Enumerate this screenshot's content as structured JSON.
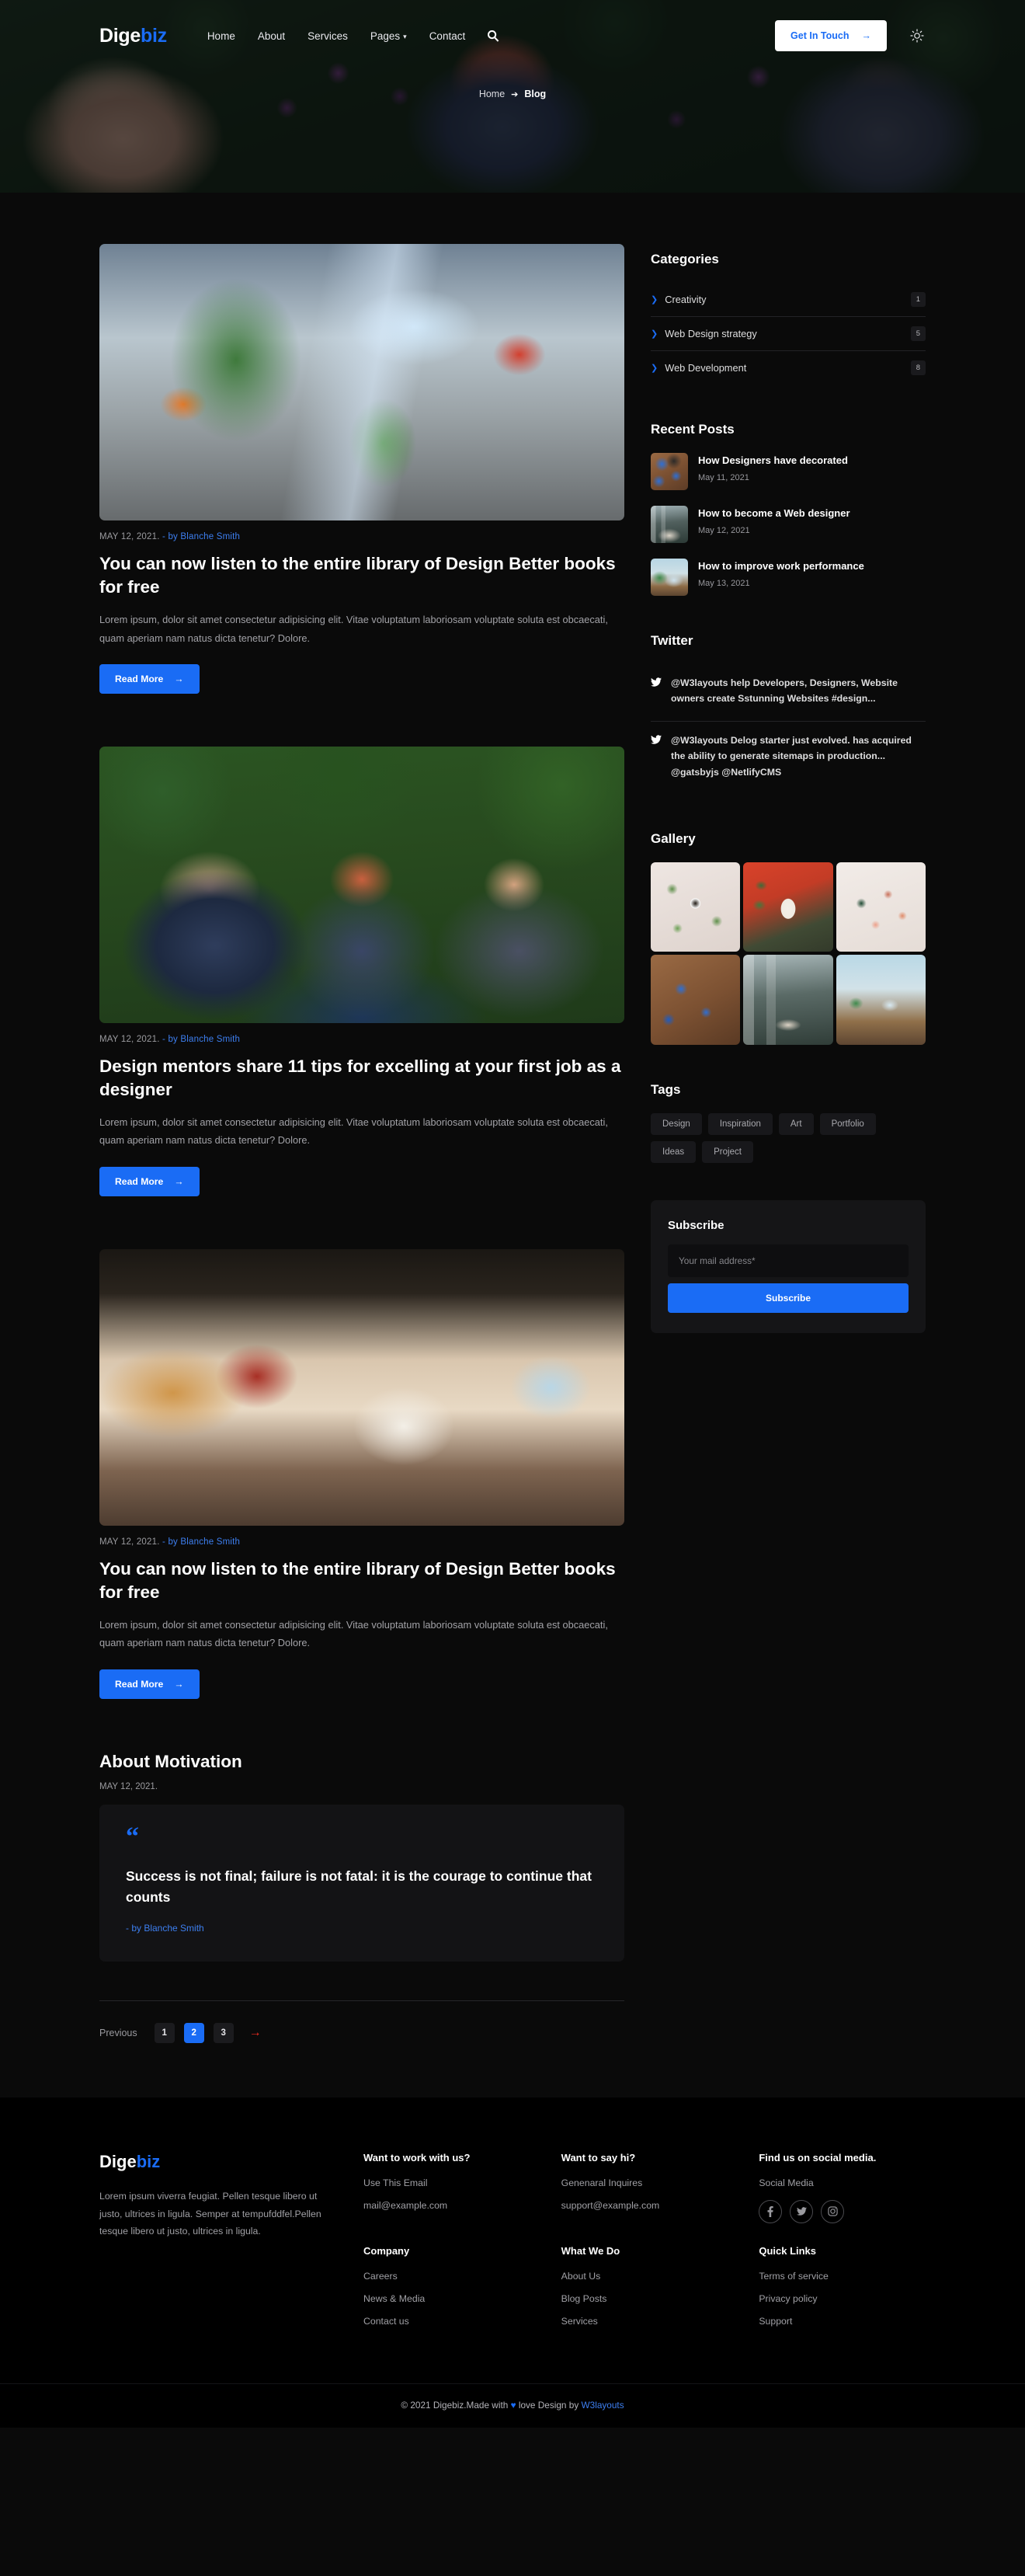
{
  "header": {
    "logo_main": "Dige",
    "logo_accent": "biz",
    "nav": [
      {
        "label": "Home",
        "caret": false
      },
      {
        "label": "About",
        "caret": false
      },
      {
        "label": "Services",
        "caret": false
      },
      {
        "label": "Pages",
        "caret": true
      },
      {
        "label": "Contact",
        "caret": false
      }
    ],
    "search_icon": "search-icon",
    "cta_label": "Get In Touch",
    "cta_arrow": "→",
    "theme_icon": "sun-icon"
  },
  "breadcrumb": {
    "home": "Home",
    "separator": "➔",
    "current": "Blog"
  },
  "posts": [
    {
      "image": "office-open-plan",
      "date": "MAY 12, 2021.",
      "author": "- by Blanche Smith",
      "title": "You can now listen to the entire library of Design Better books for free",
      "excerpt": "Lorem ipsum, dolor sit amet consectetur adipisicing elit. Vitae voluptatum laboriosam voluptate soluta est obcaecati, quam aperiam nam natus dicta tenetur? Dolore.",
      "button": "Read More",
      "button_arrow": "→"
    },
    {
      "image": "team-garden-table",
      "date": "MAY 12, 2021.",
      "author": "- by Blanche Smith",
      "title": "Design mentors share 11 tips for excelling at your first job as a designer",
      "excerpt": "Lorem ipsum, dolor sit amet consectetur adipisicing elit. Vitae voluptatum laboriosam voluptate soluta est obcaecati, quam aperiam nam natus dicta tenetur? Dolore.",
      "button": "Read More",
      "button_arrow": "→"
    },
    {
      "image": "office-warm-loft",
      "date": "MAY 12, 2021.",
      "author": "- by Blanche Smith",
      "title": "You can now listen to the entire library of Design Better books for free",
      "excerpt": "Lorem ipsum, dolor sit amet consectetur adipisicing elit. Vitae voluptatum laboriosam voluptate soluta est obcaecati, quam aperiam nam natus dicta tenetur? Dolore.",
      "button": "Read More",
      "button_arrow": "→"
    }
  ],
  "motivation": {
    "heading": "About Motivation",
    "date": "MAY 12, 2021.",
    "quote_mark": "“",
    "quote": "Success is not final; failure is not fatal: it is the courage to continue that counts",
    "author": "- by Blanche Smith"
  },
  "pagination": {
    "previous": "Previous",
    "pages": [
      "1",
      "2",
      "3"
    ],
    "active": "2",
    "next_arrow": "→"
  },
  "sidebar": {
    "categories": {
      "title": "Categories",
      "items": [
        {
          "label": "Creativity",
          "count": "1"
        },
        {
          "label": "Web Design strategy",
          "count": "5"
        },
        {
          "label": "Web Development",
          "count": "8"
        }
      ]
    },
    "recent_posts": {
      "title": "Recent Posts",
      "items": [
        {
          "title": "How Designers have decorated",
          "date": "May 11, 2021",
          "thumb": "desk-top-view"
        },
        {
          "title": "How to become a Web designer",
          "date": "May 12, 2021",
          "thumb": "cafe-meeting"
        },
        {
          "title": "How to improve work performance",
          "date": "May 13, 2021",
          "thumb": "window-desk"
        }
      ]
    },
    "twitter": {
      "title": "Twitter",
      "items": [
        {
          "text": "@W3layouts help Developers, Designers, Website owners create Sstunning Websites #design..."
        },
        {
          "text": "@W3layouts Delog starter just evolved. has acquired the ability to generate sitemaps in production... @gatsbyjs @NetlifyCMS"
        }
      ]
    },
    "gallery": {
      "title": "Gallery",
      "items": [
        "coffee-plants-flatlay",
        "giraffe-illustration",
        "watercolor-circles",
        "desk-top-view",
        "cafe-meeting",
        "window-desk"
      ]
    },
    "tags": {
      "title": "Tags",
      "items": [
        "Design",
        "Inspiration",
        "Art",
        "Portfolio",
        "Ideas",
        "Project"
      ]
    },
    "subscribe": {
      "title": "Subscribe",
      "placeholder": "Your mail address*",
      "button": "Subscribe"
    }
  },
  "footer": {
    "logo_main": "Dige",
    "logo_accent": "biz",
    "description": "Lorem ipsum viverra feugiat. Pellen tesque libero ut justo, ultrices in ligula. Semper at tempufddfel.Pellen tesque libero ut justo, ultrices in ligula.",
    "columns": [
      {
        "title": "Want to work with us?",
        "links": [
          "Use This Email",
          "mail@example.com"
        ]
      },
      {
        "title": "Want to say hi?",
        "links": [
          "Genenaral Inquires",
          "support@example.com"
        ]
      },
      {
        "title": "Find us on social media.",
        "links": [
          "Social Media"
        ],
        "social": [
          "facebook-icon",
          "twitter-icon",
          "instagram-icon"
        ]
      },
      {
        "title": "Company",
        "links": [
          "Careers",
          "News & Media",
          "Contact us"
        ]
      },
      {
        "title": "What We Do",
        "links": [
          "About Us",
          "Blog Posts",
          "Services"
        ]
      },
      {
        "title": "Quick Links",
        "links": [
          "Terms of service",
          "Privacy policy",
          "Support"
        ]
      }
    ],
    "copyright_pre": "© 2021 Digebiz.Made with ",
    "copyright_heart": "♥",
    "copyright_mid": " love Design by ",
    "copyright_link": "W3layouts"
  },
  "colors": {
    "accent": "#1a6cf5",
    "link": "#3d7ff0",
    "background": "#0a0a0a",
    "card": "#131315",
    "next_arrow": "#ef2b20"
  }
}
